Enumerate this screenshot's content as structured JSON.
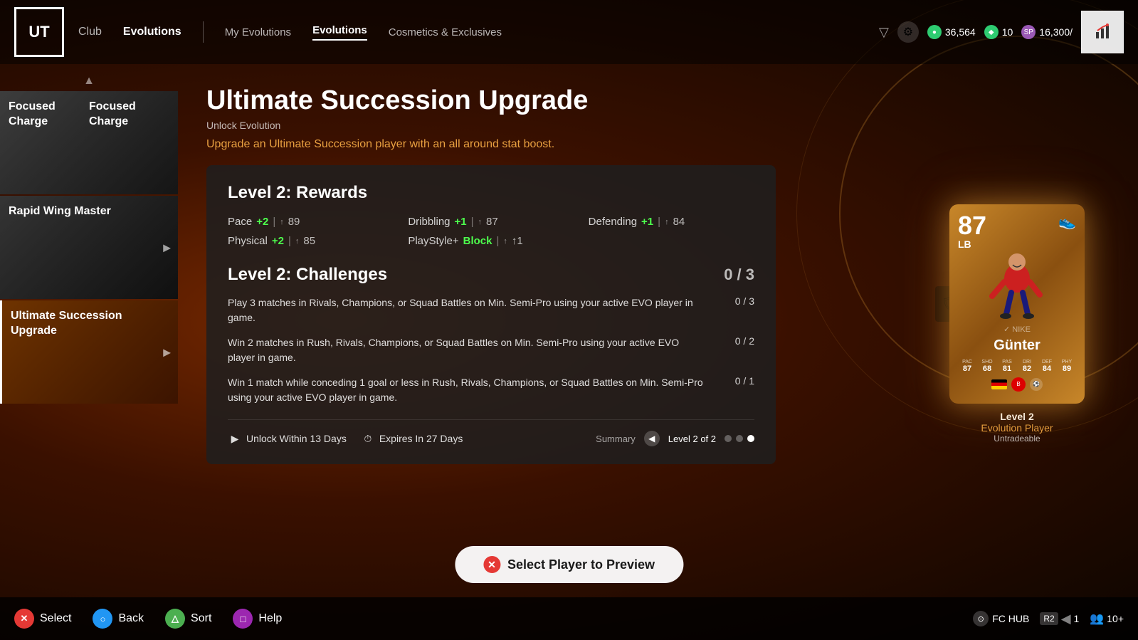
{
  "nav": {
    "logo": "UT",
    "club": "Club",
    "evolutions": "Evolutions",
    "my_evolutions": "My Evolutions",
    "evolutions_tab": "Evolutions",
    "cosmetics": "Cosmetics & Exclusives",
    "currency_1_val": "36,564",
    "currency_2_val": "10",
    "currency_3_val": "16,300/"
  },
  "sidebar": {
    "item1_label": "Focused Charge",
    "item2_label": "Rapid Wing Master",
    "item3_label": "Ultimate Succession Upgrade"
  },
  "main": {
    "title": "Ultimate Succession Upgrade",
    "unlock_label": "Unlock Evolution",
    "description": "Upgrade an Ultimate Succession player with an all around stat boost.",
    "rewards_title": "Level 2: Rewards",
    "pace_label": "Pace",
    "pace_plus": "+2",
    "pace_sep": "|",
    "pace_val": "89",
    "dribbling_label": "Dribbling",
    "dribbling_plus": "+1",
    "dribbling_sep": "|",
    "dribbling_val": "87",
    "defending_label": "Defending",
    "defending_plus": "+1",
    "defending_sep": "|",
    "defending_val": "84",
    "physical_label": "Physical",
    "physical_plus": "+2",
    "physical_sep": "|",
    "physical_val": "85",
    "playstyle_label": "PlayStyle+",
    "playstyle_val": "Block",
    "playstyle_icon": "↑1",
    "challenges_title": "Level 2: Challenges",
    "challenge_count": "0 / 3",
    "challenge1_text": "Play 3 matches in Rivals, Champions, or Squad Battles on Min. Semi-Pro using your active EVO player in game.",
    "challenge1_prog": "0 / 3",
    "challenge2_text": "Win 2 matches in Rush, Rivals, Champions, or Squad Battles on Min. Semi-Pro using your active EVO player in game.",
    "challenge2_prog": "0 / 2",
    "challenge3_text": "Win 1 match while conceding 1 goal or less in Rush, Rivals, Champions, or Squad Battles on Min. Semi-Pro using your active EVO player in game.",
    "challenge3_prog": "0 / 1",
    "unlock_days": "Unlock Within 13 Days",
    "expires_days": "Expires In 27 Days",
    "summary_label": "Summary",
    "level_text": "Level 2 of 2"
  },
  "player_card": {
    "rating": "87",
    "position": "LB",
    "name": "Günter",
    "pac": "87",
    "sho": "68",
    "pas": "81",
    "dri": "82",
    "def": "84",
    "phy": "89",
    "pac_label": "PAC",
    "sho_label": "SHO",
    "pas_label": "PAS",
    "dri_label": "DRI",
    "def_label": "DEF",
    "phy_label": "PHY",
    "level_label": "Level 2",
    "evo_label": "Evolution Player",
    "untradeable_label": "Untradeable"
  },
  "select_player_btn": "Select Player to Preview",
  "bottom_bar": {
    "select": "Select",
    "back": "Back",
    "sort": "Sort",
    "help": "Help",
    "fc_hub": "FC HUB",
    "r2_val": "1",
    "players_label": "10+"
  }
}
